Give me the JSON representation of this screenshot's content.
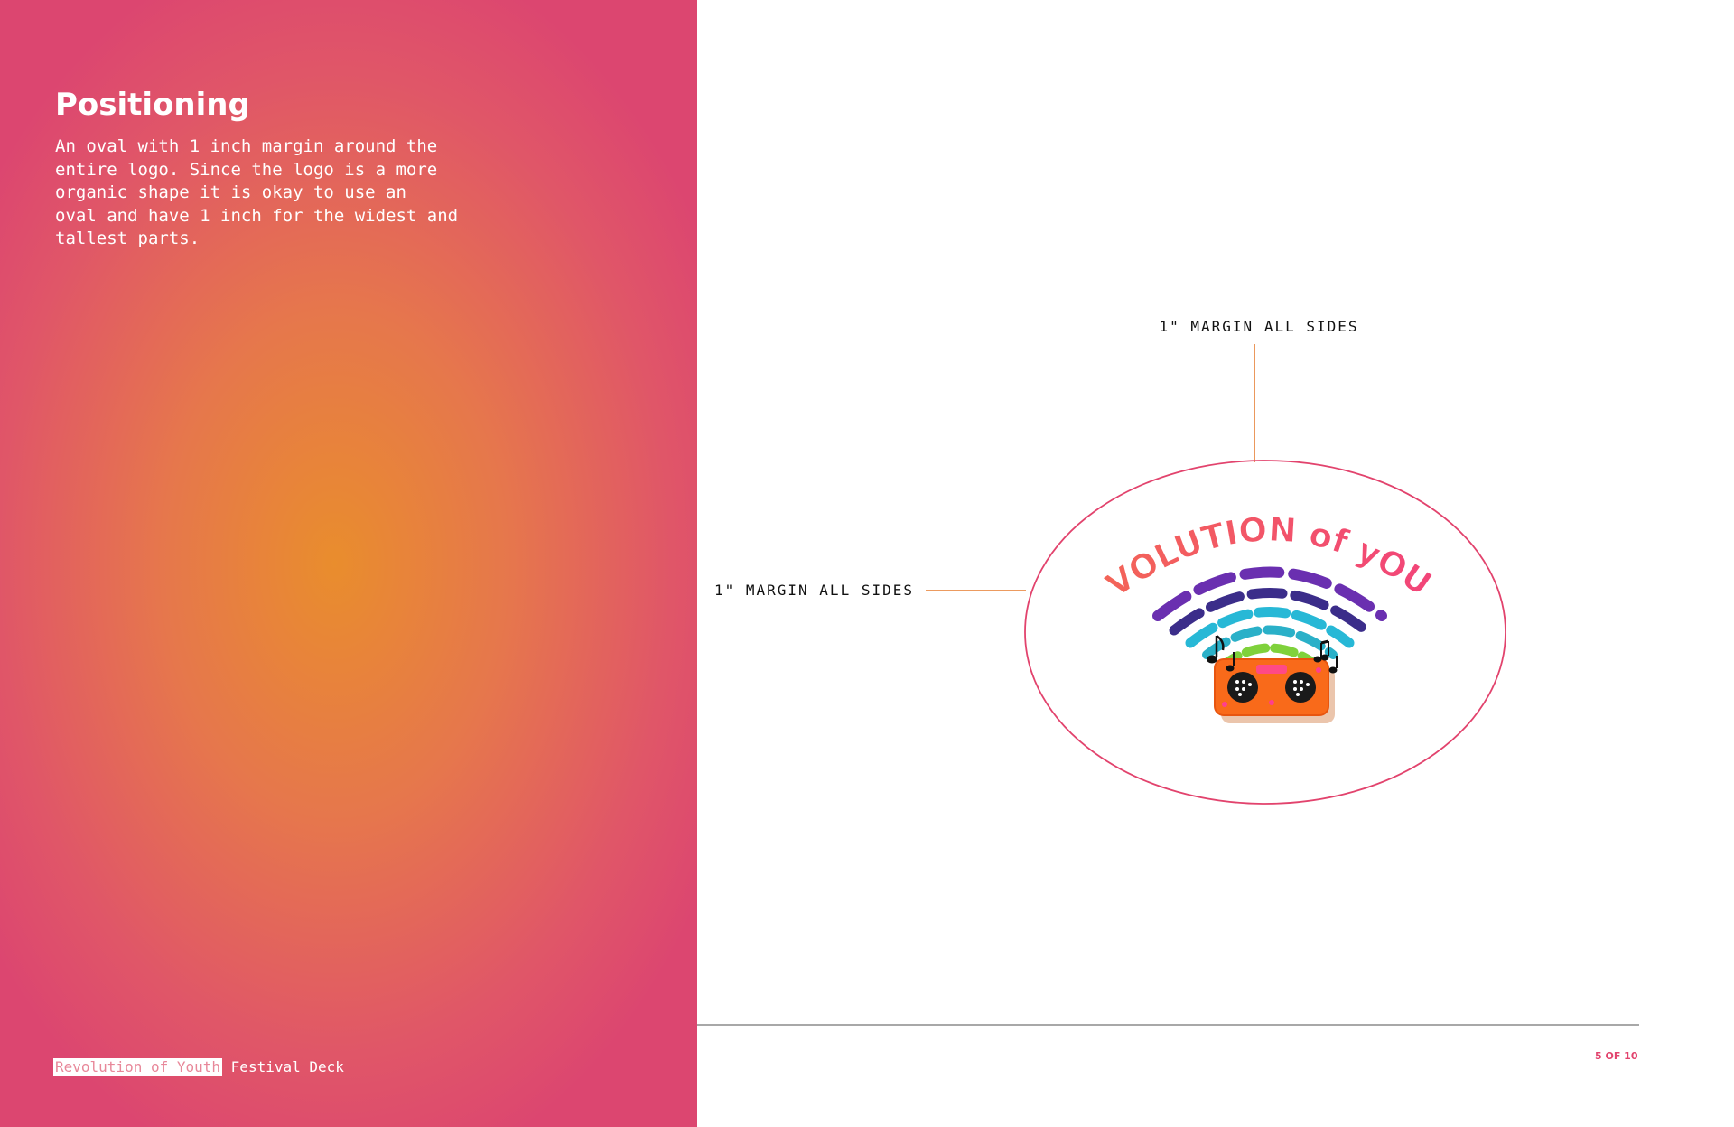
{
  "heading": "Positioning",
  "body": "An oval with 1 inch margin around the\nentire logo. Since the logo is a more\norganic shape it is okay to use an\noval and have 1 inch for the widest and\ntallest parts.",
  "diagram": {
    "top_label": "1\" MARGIN ALL SIDES",
    "side_label": "1\" MARGIN ALL SIDES",
    "logo_text": "RéVOLUTION of yOUTH"
  },
  "footer": {
    "highlight": "Revolution of Youth",
    "suffix": "Festival Deck"
  },
  "page_number": "5 OF 10",
  "colors": {
    "accent_pink": "#e2436d",
    "accent_orange": "#e98d2d",
    "rule_gray": "#a8a8a8"
  }
}
